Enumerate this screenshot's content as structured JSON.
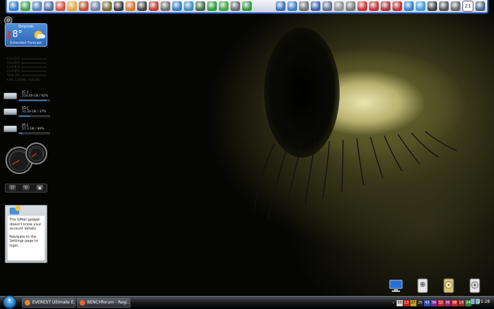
{
  "dock": {
    "icons": [
      {
        "name": "browser-globe-icon",
        "color": "#2f7fd0"
      },
      {
        "name": "refresh-green-icon",
        "color": "#3aa34a"
      },
      {
        "name": "document-icon",
        "color": "#5a7fbf"
      },
      {
        "name": "spreadsheet-icon",
        "color": "#4f6f9f"
      },
      {
        "name": "paint-icon",
        "color": "#d8513c"
      },
      {
        "name": "mail-icon",
        "color": "#e7a838"
      },
      {
        "name": "office-icon",
        "color": "#c84a2e"
      },
      {
        "name": "calculator-icon",
        "color": "#6a7fa6"
      },
      {
        "name": "media-disc-icon",
        "color": "#7a6a2e"
      },
      {
        "name": "player-icon",
        "color": "#3a3a3a"
      },
      {
        "name": "rocket-icon",
        "color": "#e2742b"
      },
      {
        "name": "film-icon",
        "color": "#444"
      },
      {
        "name": "flag-icon",
        "color": "#c8372e"
      },
      {
        "name": "gamepad-icon",
        "color": "#6e6e6e"
      },
      {
        "name": "antivirus-icon",
        "color": "#2e7fc8"
      },
      {
        "name": "network-icon",
        "color": "#3d8fc8"
      },
      {
        "name": "eye-icon",
        "color": "#3f6b3f"
      },
      {
        "name": "phone-icon",
        "color": "#2a9d3a"
      },
      {
        "name": "power-icon",
        "color": "#38a83a"
      },
      {
        "name": "usb-icon",
        "color": "#6a6a6a"
      },
      {
        "name": "sync-icon",
        "color": "#2e9a3a"
      },
      {
        "name": "monitor-icon",
        "color": "#3e6fb8"
      },
      {
        "name": "globe-icon",
        "color": "#3b7fc4"
      },
      {
        "name": "clock-icon",
        "color": "#707070"
      },
      {
        "name": "book-icon",
        "color": "#3a5fa8"
      },
      {
        "name": "keyboard-icon",
        "color": "#5f6f8f"
      },
      {
        "name": "timer-icon",
        "color": "#909090"
      },
      {
        "name": "tools-icon",
        "color": "#7a7a7a"
      },
      {
        "name": "alert-icon",
        "color": "#d0302a"
      },
      {
        "name": "opera-icon",
        "color": "#c83030"
      },
      {
        "name": "search-icon",
        "color": "#b03030"
      },
      {
        "name": "stop-icon",
        "color": "#c82a2a"
      },
      {
        "name": "ie-icon",
        "color": "#2f85d0"
      },
      {
        "name": "twitter-icon",
        "color": "#3e9ad8"
      },
      {
        "name": "star-icon",
        "color": "#404040"
      },
      {
        "name": "webcam-icon",
        "color": "#555"
      },
      {
        "name": "camera-icon",
        "color": "#666"
      },
      {
        "name": "calendar-icon",
        "color": "#6f86a8"
      },
      {
        "name": "desktop-icon",
        "color": "#4a5f80"
      }
    ],
    "calendar_day": "21"
  },
  "weather": {
    "city": "Belgrade",
    "temp": "8°",
    "forecast_link": "Extended Forecast"
  },
  "cpu_meter": {
    "rows": [
      {
        "label": "Core1",
        "value": "2%"
      },
      {
        "label": "Core2",
        "value": "3%"
      },
      {
        "label": "Core3",
        "value": "1%"
      },
      {
        "label": "Core4",
        "value": "2%"
      },
      {
        "label": "Total",
        "value": "2%"
      }
    ],
    "ram": "RAM: 1335MB / 4095MB"
  },
  "drives": [
    {
      "letter": "[C:]",
      "info": "214.69 GB / 92%",
      "fill": 0.92
    },
    {
      "letter": "[D:]",
      "info": "31.39 GB / 37%",
      "fill": 0.37
    },
    {
      "letter": "[E:]",
      "info": "27.3 GB / 89%",
      "fill": 0.12
    }
  ],
  "gmail": {
    "message1": "The GMail gadget doesn't know your account details.",
    "message2": "Navigate to the Settings page to login."
  },
  "taskbar": {
    "tasks": [
      {
        "label": "EVEREST Ultimate E...",
        "icon_color": "#e28a2a"
      },
      {
        "label": "BENCHforum - Regi...",
        "icon_color": "#e06a28"
      }
    ],
    "core_temps": [
      {
        "value": "33",
        "bg": "#d8d8d8",
        "fg": "#000"
      },
      {
        "value": "13",
        "bg": "#c82020",
        "fg": "#fff"
      },
      {
        "value": "27",
        "bg": "#d0a020",
        "fg": "#000"
      },
      {
        "value": "25",
        "bg": "#222",
        "fg": "#fff"
      },
      {
        "value": "43",
        "bg": "#2a4fc8",
        "fg": "#fff"
      },
      {
        "value": "36",
        "bg": "#7a2a9a",
        "fg": "#fff"
      },
      {
        "value": "32",
        "bg": "#c82a2a",
        "fg": "#fff"
      },
      {
        "value": "36",
        "bg": "#a02070",
        "fg": "#fff"
      },
      {
        "value": "38",
        "bg": "#c83030",
        "fg": "#fff"
      },
      {
        "value": "18",
        "bg": "#a02a2a",
        "fg": "#fff"
      },
      {
        "value": "34",
        "bg": "#2a8a3a",
        "fg": "#fff"
      }
    ],
    "clock": "21:28"
  }
}
